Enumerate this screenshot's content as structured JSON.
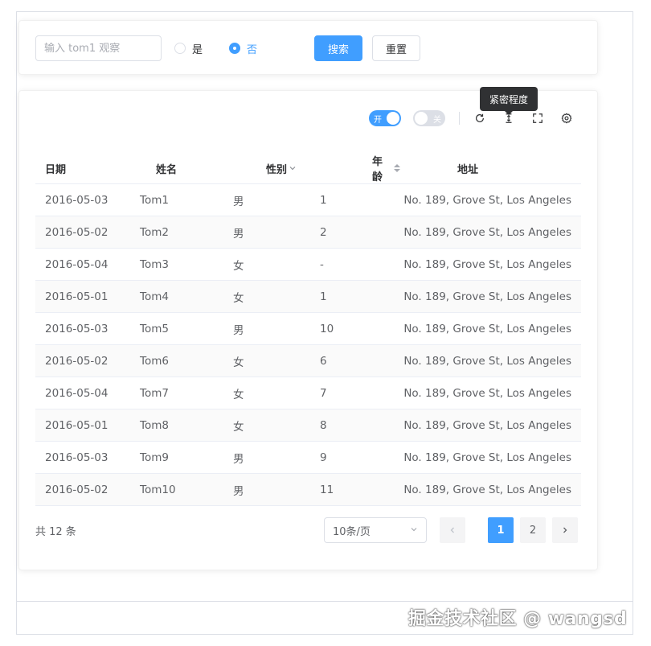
{
  "search": {
    "placeholder": "输入 tom1 观察",
    "radio_yes": "是",
    "radio_no": "否",
    "search_button": "搜索",
    "reset_button": "重置"
  },
  "toolbar": {
    "switch_on_text": "开",
    "switch_off_text": "关",
    "tooltip": "紧密程度",
    "icons": [
      "refresh-icon",
      "density-icon",
      "fullscreen-icon",
      "settings-icon"
    ]
  },
  "table": {
    "headers": {
      "date": "日期",
      "name": "姓名",
      "gender": "性别",
      "age": "年龄",
      "address": "地址"
    },
    "rows": [
      {
        "date": "2016-05-03",
        "name": "Tom1",
        "gender": "男",
        "age": "1",
        "address": "No. 189, Grove St, Los Angeles"
      },
      {
        "date": "2016-05-02",
        "name": "Tom2",
        "gender": "男",
        "age": "2",
        "address": "No. 189, Grove St, Los Angeles"
      },
      {
        "date": "2016-05-04",
        "name": "Tom3",
        "gender": "女",
        "age": "-",
        "address": "No. 189, Grove St, Los Angeles"
      },
      {
        "date": "2016-05-01",
        "name": "Tom4",
        "gender": "女",
        "age": "1",
        "address": "No. 189, Grove St, Los Angeles"
      },
      {
        "date": "2016-05-03",
        "name": "Tom5",
        "gender": "男",
        "age": "10",
        "address": "No. 189, Grove St, Los Angeles"
      },
      {
        "date": "2016-05-02",
        "name": "Tom6",
        "gender": "女",
        "age": "6",
        "address": "No. 189, Grove St, Los Angeles"
      },
      {
        "date": "2016-05-04",
        "name": "Tom7",
        "gender": "女",
        "age": "7",
        "address": "No. 189, Grove St, Los Angeles"
      },
      {
        "date": "2016-05-01",
        "name": "Tom8",
        "gender": "女",
        "age": "8",
        "address": "No. 189, Grove St, Los Angeles"
      },
      {
        "date": "2016-05-03",
        "name": "Tom9",
        "gender": "男",
        "age": "9",
        "address": "No. 189, Grove St, Los Angeles"
      },
      {
        "date": "2016-05-02",
        "name": "Tom10",
        "gender": "男",
        "age": "11",
        "address": "No. 189, Grove St, Los Angeles"
      }
    ]
  },
  "pagination": {
    "total": "共 12 条",
    "page_size": "10条/页",
    "pages": [
      "1",
      "2"
    ],
    "current_page": "1"
  },
  "watermark": "掘金技术社区 @ wangsd",
  "colors": {
    "primary": "#409eff",
    "border": "#dcdfe6",
    "text": "#606266"
  }
}
